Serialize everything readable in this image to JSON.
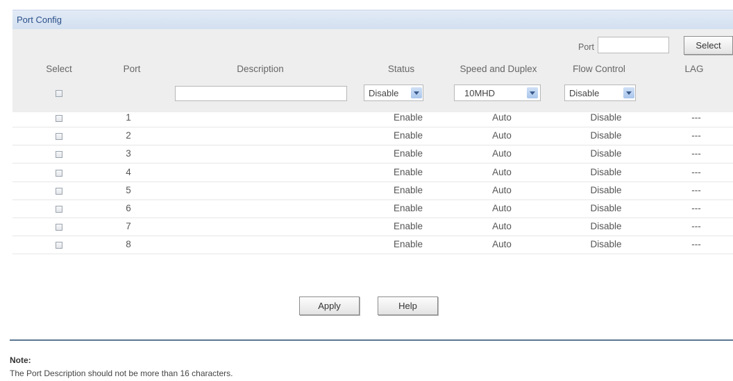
{
  "panel": {
    "title": "Port Config"
  },
  "search": {
    "port_label": "Port",
    "port_value": "",
    "select_button": "Select"
  },
  "columns": [
    "Select",
    "Port",
    "Description",
    "Status",
    "Speed and Duplex",
    "Flow Control",
    "LAG"
  ],
  "config_row": {
    "description_value": "",
    "status_value": "Disable",
    "speed_value": "10MHD",
    "flow_value": "Disable"
  },
  "rows": [
    {
      "port": "1",
      "status": "Enable",
      "speed": "Auto",
      "flow": "Disable",
      "lag": "---"
    },
    {
      "port": "2",
      "status": "Enable",
      "speed": "Auto",
      "flow": "Disable",
      "lag": "---"
    },
    {
      "port": "3",
      "status": "Enable",
      "speed": "Auto",
      "flow": "Disable",
      "lag": "---"
    },
    {
      "port": "4",
      "status": "Enable",
      "speed": "Auto",
      "flow": "Disable",
      "lag": "---"
    },
    {
      "port": "5",
      "status": "Enable",
      "speed": "Auto",
      "flow": "Disable",
      "lag": "---"
    },
    {
      "port": "6",
      "status": "Enable",
      "speed": "Auto",
      "flow": "Disable",
      "lag": "---"
    },
    {
      "port": "7",
      "status": "Enable",
      "speed": "Auto",
      "flow": "Disable",
      "lag": "---"
    },
    {
      "port": "8",
      "status": "Enable",
      "speed": "Auto",
      "flow": "Disable",
      "lag": "---"
    }
  ],
  "buttons": {
    "apply": "Apply",
    "help": "Help"
  },
  "note": {
    "title": "Note:",
    "text": "The Port Description should not be more than 16 characters."
  },
  "colors": {
    "title_bar": "#d3e0f0",
    "title_text": "#2a4f8a",
    "panel_bg": "#eeeeee",
    "note_rule": "#5a7691"
  }
}
